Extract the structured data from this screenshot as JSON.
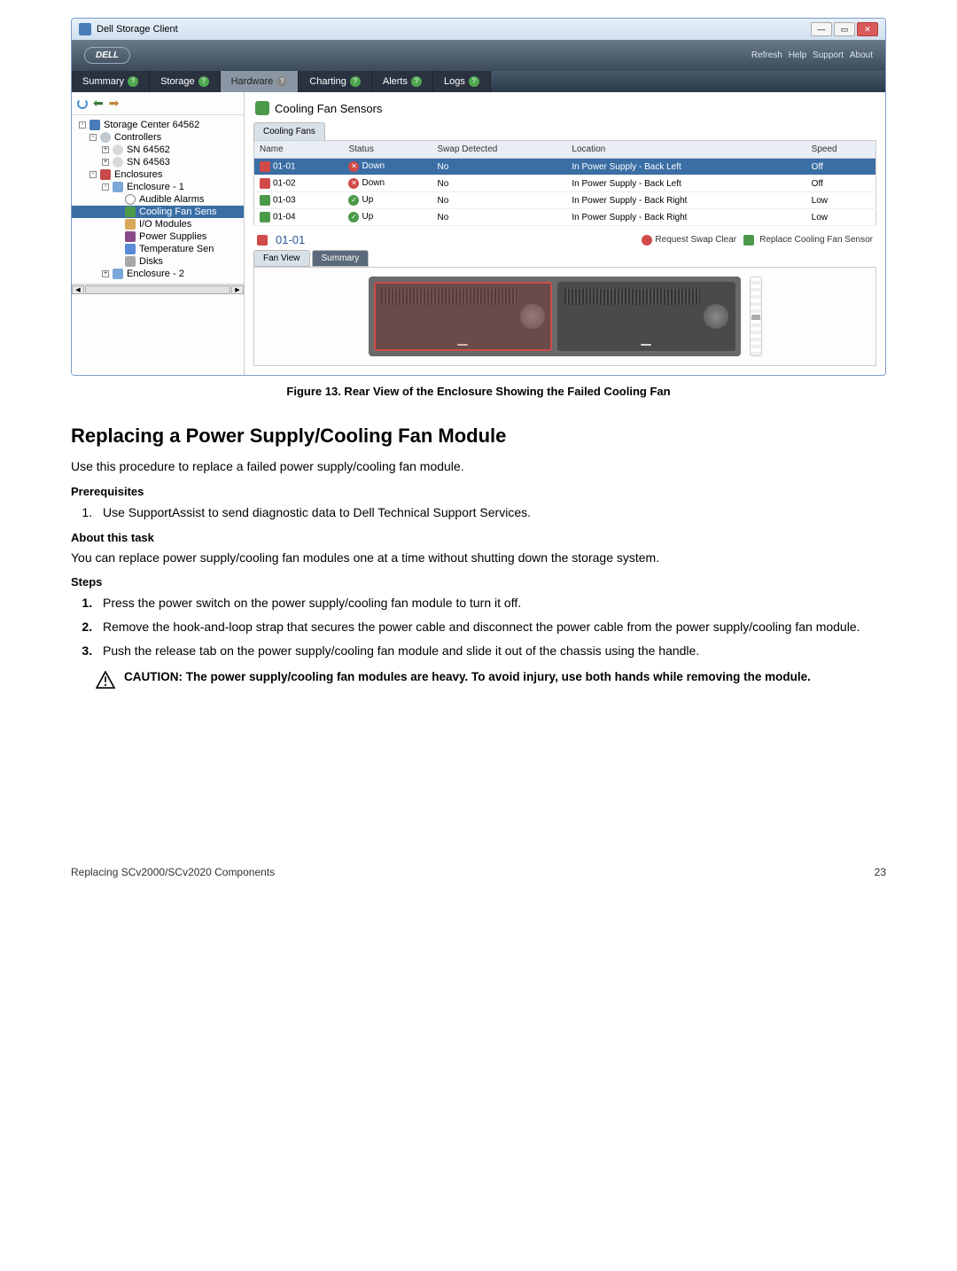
{
  "screenshot": {
    "window_title": "Dell Storage Client",
    "brand": "DELL",
    "brand_links": [
      "Refresh",
      "Help",
      "Support",
      "About"
    ],
    "top_tabs": [
      {
        "label": "Summary",
        "kind": "dark",
        "q": "green"
      },
      {
        "label": "Storage",
        "kind": "dark",
        "q": "green"
      },
      {
        "label": "Hardware",
        "kind": "light",
        "q": "gray",
        "qtext": "?"
      },
      {
        "label": "Charting",
        "kind": "dark",
        "q": "green"
      },
      {
        "label": "Alerts",
        "kind": "dark",
        "q": "green"
      },
      {
        "label": "Logs",
        "kind": "dark",
        "q": "green"
      }
    ],
    "tree": [
      {
        "label": "Storage Center 64562",
        "ico": "ico-storage",
        "indent": 0,
        "box": "-"
      },
      {
        "label": "Controllers",
        "ico": "ico-ctrl",
        "indent": 1,
        "box": "-"
      },
      {
        "label": "SN 64562",
        "ico": "ico-sn",
        "indent": 2,
        "box": "+"
      },
      {
        "label": "SN 64563",
        "ico": "ico-sn",
        "indent": 2,
        "box": "+"
      },
      {
        "label": "Enclosures",
        "ico": "ico-enc",
        "indent": 1,
        "box": "-"
      },
      {
        "label": "Enclosure - 1",
        "ico": "ico-encitem",
        "indent": 2,
        "box": "-"
      },
      {
        "label": "Audible Alarms",
        "ico": "ico-alarm",
        "indent": 3
      },
      {
        "label": "Cooling Fan Sens",
        "ico": "ico-fan",
        "indent": 3,
        "selected": true
      },
      {
        "label": "I/O Modules",
        "ico": "ico-iomod",
        "indent": 3
      },
      {
        "label": "Power Supplies",
        "ico": "ico-power",
        "indent": 3
      },
      {
        "label": "Temperature Sen",
        "ico": "ico-temp",
        "indent": 3
      },
      {
        "label": "Disks",
        "ico": "ico-disk",
        "indent": 3
      },
      {
        "label": "Enclosure - 2",
        "ico": "ico-encitem",
        "indent": 2,
        "box": "+"
      }
    ],
    "section_title": "Cooling Fan Sensors",
    "inner_tab": "Cooling Fans",
    "table": {
      "headers": [
        "Name",
        "Status",
        "Swap Detected",
        "Location",
        "Speed"
      ],
      "rows": [
        {
          "name": "01-01",
          "status": "Down",
          "status_kind": "down",
          "swap": "No",
          "loc": "In Power Supply - Back Left",
          "speed": "Off",
          "sel": true,
          "fan": "red"
        },
        {
          "name": "01-02",
          "status": "Down",
          "status_kind": "down",
          "swap": "No",
          "loc": "In Power Supply - Back Left",
          "speed": "Off",
          "fan": "red"
        },
        {
          "name": "01-03",
          "status": "Up",
          "status_kind": "up",
          "swap": "No",
          "loc": "In Power Supply - Back Right",
          "speed": "Low",
          "fan": "green"
        },
        {
          "name": "01-04",
          "status": "Up",
          "status_kind": "up",
          "swap": "No",
          "loc": "In Power Supply - Back Right",
          "speed": "Low",
          "fan": "green"
        }
      ]
    },
    "detail_name": "01-01",
    "detail_links": [
      {
        "label": "Request Swap Clear",
        "ico": "swap"
      },
      {
        "label": "Replace Cooling Fan Sensor",
        "ico": "fan"
      }
    ],
    "detail_tabs": [
      "Fan View",
      "Summary"
    ],
    "psu_left_label": "",
    "psu_right_label": ""
  },
  "figure_caption": "Figure 13. Rear View of the Enclosure Showing the Failed Cooling Fan",
  "heading": "Replacing a Power Supply/Cooling Fan Module",
  "intro": "Use this procedure to replace a failed power supply/cooling fan module.",
  "prereq_heading": "Prerequisites",
  "prereq_items": [
    "Use SupportAssist to send diagnostic data to Dell Technical Support Services."
  ],
  "about_heading": "About this task",
  "about_body": "You can replace power supply/cooling fan modules one at a time without shutting down the storage system.",
  "steps_heading": "Steps",
  "steps": [
    "Press the power switch on the power supply/cooling fan module to turn it off.",
    "Remove the hook-and-loop strap that secures the power cable and disconnect the power cable from the power supply/cooling fan module.",
    "Push the release tab on the power supply/cooling fan module and slide it out of the chassis using the handle."
  ],
  "caution": "CAUTION: The power supply/cooling fan modules are heavy. To avoid injury, use both hands while removing the module.",
  "footer_left": "Replacing SCv2000/SCv2020 Components",
  "footer_right": "23"
}
